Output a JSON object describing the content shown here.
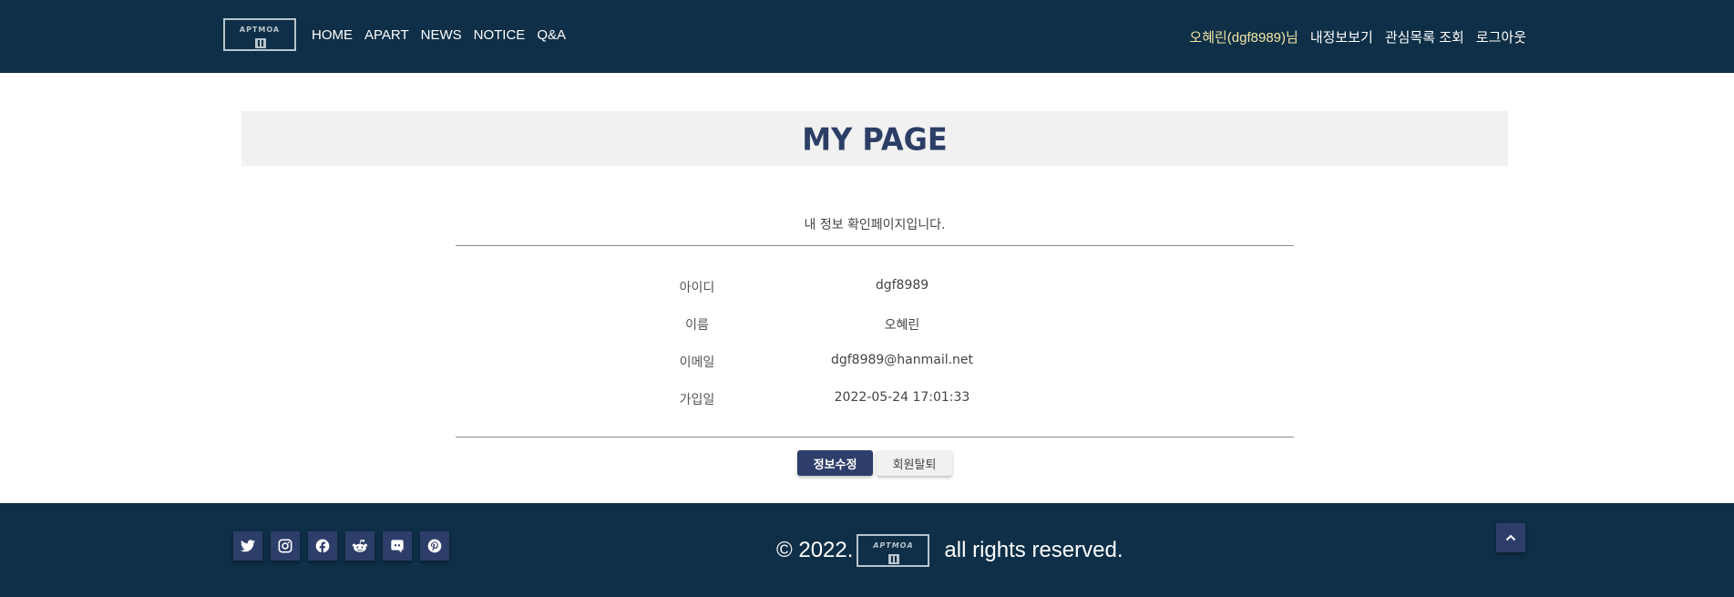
{
  "header": {
    "logo_text": "APTMOA",
    "nav": [
      "HOME",
      "APART",
      "NEWS",
      "NOTICE",
      "Q&A"
    ],
    "user_greeting": "오혜린(dgf8989)님",
    "links": [
      "내정보보기",
      "관심목록 조회",
      "로그아웃"
    ]
  },
  "main": {
    "title": "MY PAGE",
    "subtitle": "내 정보 확인페이지입니다.",
    "info": [
      {
        "label": "아이디",
        "value": "dgf8989"
      },
      {
        "label": "이름",
        "value": "오혜린"
      },
      {
        "label": "이메일",
        "value": "dgf8989@hanmail.net"
      },
      {
        "label": "가입일",
        "value": "2022-05-24 17:01:33"
      }
    ],
    "edit_label": "정보수정",
    "withdraw_label": "회원탈퇴"
  },
  "footer": {
    "social_icons": [
      "twitter-icon",
      "instagram-icon",
      "facebook-icon",
      "reddit-icon",
      "discord-icon",
      "pinterest-icon"
    ],
    "copyright_prefix": "© 2022.",
    "logo_text": "APTMOA",
    "copyright_suffix": "all rights reserved."
  },
  "colors": {
    "navbar": "#0e2f47",
    "accent": "#2d3e6a",
    "user_highlight": "#f3e6a2",
    "banner": "#f1f1f1"
  }
}
